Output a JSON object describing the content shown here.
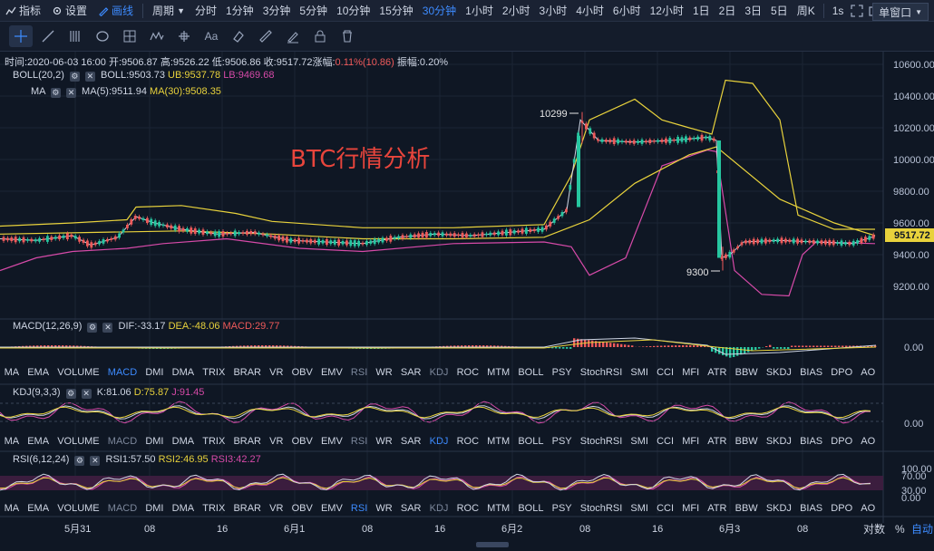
{
  "top": {
    "left_buttons": [
      {
        "label": "指标",
        "icon": "indicator-icon"
      },
      {
        "label": "设置",
        "icon": "gear-icon"
      },
      {
        "label": "画线",
        "icon": "pen-icon"
      }
    ],
    "period_label": "周期",
    "periods": [
      "分时",
      "1分钟",
      "3分钟",
      "5分钟",
      "10分钟",
      "15分钟",
      "30分钟",
      "1小时",
      "2小时",
      "3小时",
      "4小时",
      "6小时",
      "12小时",
      "1日",
      "2日",
      "3日",
      "5日",
      "周K"
    ],
    "active_period": "30分钟",
    "seconds_label": "1s",
    "window_label": "单窗口"
  },
  "drawing_tools": [
    "crosshair-icon",
    "line-tool-icon",
    "parallel-lines-icon",
    "circle-tool-icon",
    "grid-tool-icon",
    "wave-tool-icon",
    "measure-tool-icon",
    "text-tool-icon",
    "eraser-icon",
    "ruler-icon",
    "edit-pen-icon",
    "lock-icon",
    "trash-icon"
  ],
  "info_line": {
    "time": "时间:2020-06-03 16:00",
    "open": "开:9506.87",
    "high": "高:9526.22",
    "low": "低:9506.86",
    "close": "收:9517.72",
    "change_label": "涨幅:",
    "change": "0.11%(10.86)",
    "amp": "振幅:0.20%"
  },
  "boll": {
    "name": "BOLL(20,2)",
    "mid": "BOLL:9503.73",
    "ub": "UB:9537.78",
    "lb": "LB:9469.68"
  },
  "ma": {
    "name": "MA",
    "ma5": "MA(5):9511.94",
    "ma30": "MA(30):9508.35"
  },
  "macd": {
    "name": "MACD(12,26,9)",
    "dif": "DIF:-33.17",
    "dea": "DEA:-48.06",
    "macd": "MACD:29.77",
    "axis": "0.00"
  },
  "kdj": {
    "name": "KDJ(9,3,3)",
    "k": "K:81.06",
    "d": "D:75.87",
    "j": "J:91.45",
    "axis": "0.00"
  },
  "rsi": {
    "name": "RSI(6,12,24)",
    "r1": "RSI1:57.50",
    "r2": "RSI2:46.95",
    "r3": "RSI3:42.27",
    "axis": [
      "100.00",
      "70.00",
      "30.00",
      "0.00"
    ]
  },
  "watermark": "BTC行情分析",
  "annotations": {
    "high": "10299",
    "low": "9300"
  },
  "price_axis": [
    "10600.00",
    "10400.00",
    "10200.00",
    "10000.00",
    "9800.00",
    "9600.00",
    "9400.00",
    "9200.00"
  ],
  "current_price": "9517.72",
  "indicator_tabs": [
    "MA",
    "EMA",
    "VOLUME",
    "MACD",
    "DMI",
    "DMA",
    "TRIX",
    "BRAR",
    "VR",
    "OBV",
    "EMV",
    "RSI",
    "WR",
    "SAR",
    "KDJ",
    "ROC",
    "MTM",
    "BOLL",
    "PSY",
    "StochRSI",
    "SMI",
    "CCI",
    "MFI",
    "ATR",
    "BBW",
    "SKDJ",
    "BIAS",
    "DPO",
    "AO"
  ],
  "time_axis": [
    "5月31",
    "08",
    "16",
    "6月1",
    "08",
    "16",
    "6月2",
    "08",
    "16",
    "6月3",
    "08"
  ],
  "bottom_right": {
    "log": "对数",
    "pct": "%",
    "auto": "自动"
  },
  "colors": {
    "accent": "#3d8bff",
    "up": "#26c6a0",
    "down": "#ef5a5a",
    "boll_band": "#e8d23c",
    "boll_lb": "#d64aa8",
    "ma5": "#cfd6e4",
    "ma30": "#e8d23c"
  },
  "chart_data": {
    "type": "line",
    "price_points": [
      [
        0,
        9500
      ],
      [
        40,
        9490
      ],
      [
        80,
        9520
      ],
      [
        100,
        9460
      ],
      [
        130,
        9510
      ],
      [
        150,
        9640
      ],
      [
        170,
        9600
      ],
      [
        200,
        9560
      ],
      [
        240,
        9530
      ],
      [
        280,
        9540
      ],
      [
        320,
        9490
      ],
      [
        360,
        9480
      ],
      [
        400,
        9470
      ],
      [
        440,
        9510
      ],
      [
        480,
        9530
      ],
      [
        520,
        9520
      ],
      [
        560,
        9540
      ],
      [
        600,
        9560
      ],
      [
        625,
        9680
      ],
      [
        640,
        10250
      ],
      [
        660,
        10120
      ],
      [
        700,
        10110
      ],
      [
        740,
        10120
      ],
      [
        780,
        10140
      ],
      [
        790,
        10120
      ],
      [
        796,
        9380
      ],
      [
        805,
        9400
      ],
      [
        820,
        9480
      ],
      [
        860,
        9490
      ],
      [
        900,
        9480
      ],
      [
        940,
        9470
      ],
      [
        965,
        9517
      ]
    ],
    "ub_points": [
      [
        0,
        9580
      ],
      [
        80,
        9600
      ],
      [
        140,
        9620
      ],
      [
        150,
        9700
      ],
      [
        200,
        9710
      ],
      [
        260,
        9660
      ],
      [
        300,
        9610
      ],
      [
        400,
        9570
      ],
      [
        500,
        9570
      ],
      [
        600,
        9590
      ],
      [
        630,
        9900
      ],
      [
        650,
        10250
      ],
      [
        700,
        10380
      ],
      [
        730,
        10250
      ],
      [
        760,
        10200
      ],
      [
        785,
        10160
      ],
      [
        800,
        10500
      ],
      [
        830,
        10480
      ],
      [
        860,
        10250
      ],
      [
        880,
        9650
      ],
      [
        920,
        9560
      ],
      [
        965,
        9560
      ]
    ],
    "lb_points": [
      [
        0,
        9300
      ],
      [
        40,
        9380
      ],
      [
        80,
        9420
      ],
      [
        140,
        9440
      ],
      [
        180,
        9470
      ],
      [
        250,
        9500
      ],
      [
        330,
        9440
      ],
      [
        400,
        9420
      ],
      [
        500,
        9470
      ],
      [
        600,
        9480
      ],
      [
        630,
        9450
      ],
      [
        650,
        9270
      ],
      [
        690,
        9380
      ],
      [
        730,
        9960
      ],
      [
        780,
        10060
      ],
      [
        790,
        10050
      ],
      [
        810,
        9300
      ],
      [
        840,
        9150
      ],
      [
        870,
        9140
      ],
      [
        885,
        9400
      ],
      [
        900,
        9480
      ],
      [
        965,
        9470
      ]
    ],
    "ma30_points": [
      [
        0,
        9530
      ],
      [
        100,
        9540
      ],
      [
        200,
        9550
      ],
      [
        300,
        9530
      ],
      [
        400,
        9500
      ],
      [
        500,
        9500
      ],
      [
        600,
        9510
      ],
      [
        650,
        9620
      ],
      [
        700,
        9850
      ],
      [
        760,
        10030
      ],
      [
        790,
        10080
      ],
      [
        860,
        9750
      ],
      [
        920,
        9600
      ],
      [
        965,
        9520
      ]
    ]
  }
}
